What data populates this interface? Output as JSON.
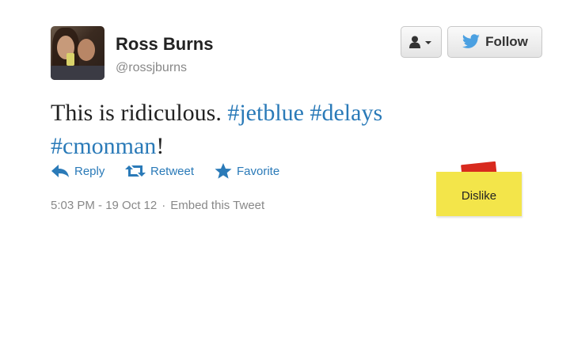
{
  "user": {
    "name": "Ross Burns",
    "handle": "@rossjburns"
  },
  "buttons": {
    "follow_label": "Follow"
  },
  "tweet": {
    "segments": [
      {
        "text": "This is ridiculous. ",
        "type": "text"
      },
      {
        "text": "#jetblue",
        "type": "hashtag"
      },
      {
        "text": " ",
        "type": "text"
      },
      {
        "text": "#delays",
        "type": "hashtag"
      },
      {
        "text": " ",
        "type": "text"
      },
      {
        "text": "#cmonman",
        "type": "hashtag"
      },
      {
        "text": "!",
        "type": "text"
      }
    ]
  },
  "actions": {
    "reply": "Reply",
    "retweet": "Retweet",
    "favorite": "Favorite"
  },
  "meta": {
    "timestamp": "5:03 PM - 19 Oct 12",
    "separator": "·",
    "embed": "Embed this Tweet"
  },
  "dislike": {
    "label": "Dislike"
  },
  "colors": {
    "link": "#2a7ab8",
    "twitter_blue": "#4ba0e1",
    "sticky_note": "#f3e54a",
    "tape": "#d82a1e"
  },
  "icons": {
    "user_menu": "person-icon",
    "follow": "twitter-bird-icon",
    "reply": "reply-arrow-icon",
    "retweet": "retweet-icon",
    "favorite": "star-icon"
  }
}
